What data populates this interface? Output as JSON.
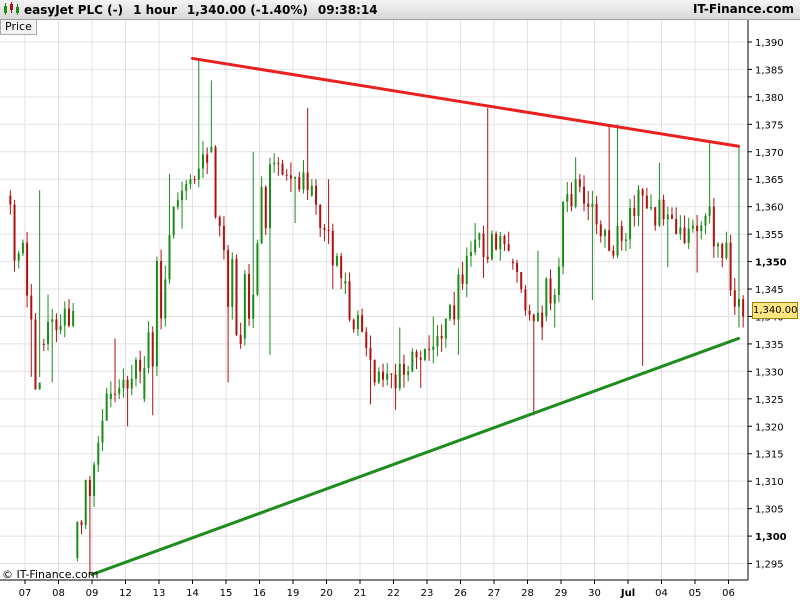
{
  "header": {
    "instrument": "easyJet PLC (-)",
    "interval": "1 hour",
    "quote": "1,340.00 (-1.40%)",
    "time": "09:38:14",
    "brand": "IT-Finance.com"
  },
  "price_label": "Price",
  "price_box": "1,340.00",
  "copyright": "© IT-Finance.com",
  "colors": {
    "up_candle": "#1a8c1a",
    "down_candle": "#b01010",
    "resistance": "#e82020",
    "support": "#1f8c1f",
    "price_box": "#ffe680"
  },
  "chart_data": {
    "type": "candlestick",
    "ylim": [
      1292,
      1394
    ],
    "y_ticks": [
      {
        "value": 1295,
        "label": "1,295"
      },
      {
        "value": 1300,
        "label": "1,300"
      },
      {
        "value": 1305,
        "label": "1,305"
      },
      {
        "value": 1310,
        "label": "1,310"
      },
      {
        "value": 1315,
        "label": "1,315"
      },
      {
        "value": 1320,
        "label": "1,320"
      },
      {
        "value": 1325,
        "label": "1,325"
      },
      {
        "value": 1330,
        "label": "1,330"
      },
      {
        "value": 1335,
        "label": "1,335"
      },
      {
        "value": 1340,
        "label": "1,340"
      },
      {
        "value": 1345,
        "label": "1,345"
      },
      {
        "value": 1350,
        "label": "1,350"
      },
      {
        "value": 1355,
        "label": "1,355"
      },
      {
        "value": 1360,
        "label": "1,360"
      },
      {
        "value": 1365,
        "label": "1,365"
      },
      {
        "value": 1370,
        "label": "1,370"
      },
      {
        "value": 1375,
        "label": "1,375"
      },
      {
        "value": 1380,
        "label": "1,380"
      },
      {
        "value": 1385,
        "label": "1,385"
      },
      {
        "value": 1390,
        "label": "1,390"
      }
    ],
    "x_ticks": [
      "07",
      "08",
      "09",
      "12",
      "13",
      "14",
      "15",
      "16",
      "19",
      "20",
      "21",
      "22",
      "23",
      "26",
      "27",
      "28",
      "29",
      "30",
      "Jul",
      "04",
      "05",
      "06"
    ],
    "last_price": 1340,
    "trendlines": [
      {
        "name": "resistance",
        "from": {
          "session": 5,
          "price": 1387
        },
        "to": {
          "session": 21.3,
          "price": 1371
        }
      },
      {
        "name": "support",
        "from": {
          "session": 2,
          "price": 1293
        },
        "to": {
          "session": 21.3,
          "price": 1336
        }
      }
    ],
    "sessions": [
      {
        "label": "07",
        "open": 1362,
        "close": 1328,
        "high": 1363,
        "low": 1329
      },
      {
        "label": "08",
        "open": 1335,
        "close": 1341,
        "high": 1344,
        "low": 1328
      },
      {
        "label": "09",
        "open": 1296,
        "close": 1326,
        "high": 1327,
        "low": 1293
      },
      {
        "label": "12",
        "open": 1325,
        "close": 1330,
        "high": 1336,
        "low": 1320
      },
      {
        "label": "13",
        "open": 1325,
        "close": 1360,
        "high": 1366,
        "low": 1322
      },
      {
        "label": "14",
        "open": 1360,
        "close": 1368,
        "high": 1387,
        "low": 1356
      },
      {
        "label": "15",
        "open": 1370,
        "close": 1335,
        "high": 1383,
        "low": 1328
      },
      {
        "label": "16",
        "open": 1336,
        "close": 1368,
        "high": 1370,
        "low": 1333
      },
      {
        "label": "19",
        "open": 1368,
        "close": 1363,
        "high": 1378,
        "low": 1357
      },
      {
        "label": "20",
        "open": 1362,
        "close": 1347,
        "high": 1365,
        "low": 1345
      },
      {
        "label": "21",
        "open": 1346,
        "close": 1328,
        "high": 1348,
        "low": 1324
      },
      {
        "label": "22",
        "open": 1328,
        "close": 1330,
        "high": 1338,
        "low": 1323
      },
      {
        "label": "23",
        "open": 1330,
        "close": 1336,
        "high": 1340,
        "low": 1327
      },
      {
        "label": "26",
        "open": 1336,
        "close": 1354,
        "high": 1357,
        "low": 1333
      },
      {
        "label": "27",
        "open": 1354,
        "close": 1352,
        "high": 1378,
        "low": 1347
      },
      {
        "label": "28",
        "open": 1350,
        "close": 1338,
        "high": 1352,
        "low": 1322
      },
      {
        "label": "29",
        "open": 1340,
        "close": 1365,
        "high": 1369,
        "low": 1338
      },
      {
        "label": "30",
        "open": 1365,
        "close": 1352,
        "high": 1375,
        "low": 1343
      },
      {
        "label": "Jul",
        "open": 1352,
        "close": 1362,
        "high": 1375,
        "low": 1331
      },
      {
        "label": "04",
        "open": 1362,
        "close": 1355,
        "high": 1368,
        "low": 1349
      },
      {
        "label": "05",
        "open": 1355,
        "close": 1360,
        "high": 1372,
        "low": 1348
      },
      {
        "label": "06",
        "open": 1360,
        "close": 1340,
        "high": 1371,
        "low": 1338
      }
    ]
  }
}
